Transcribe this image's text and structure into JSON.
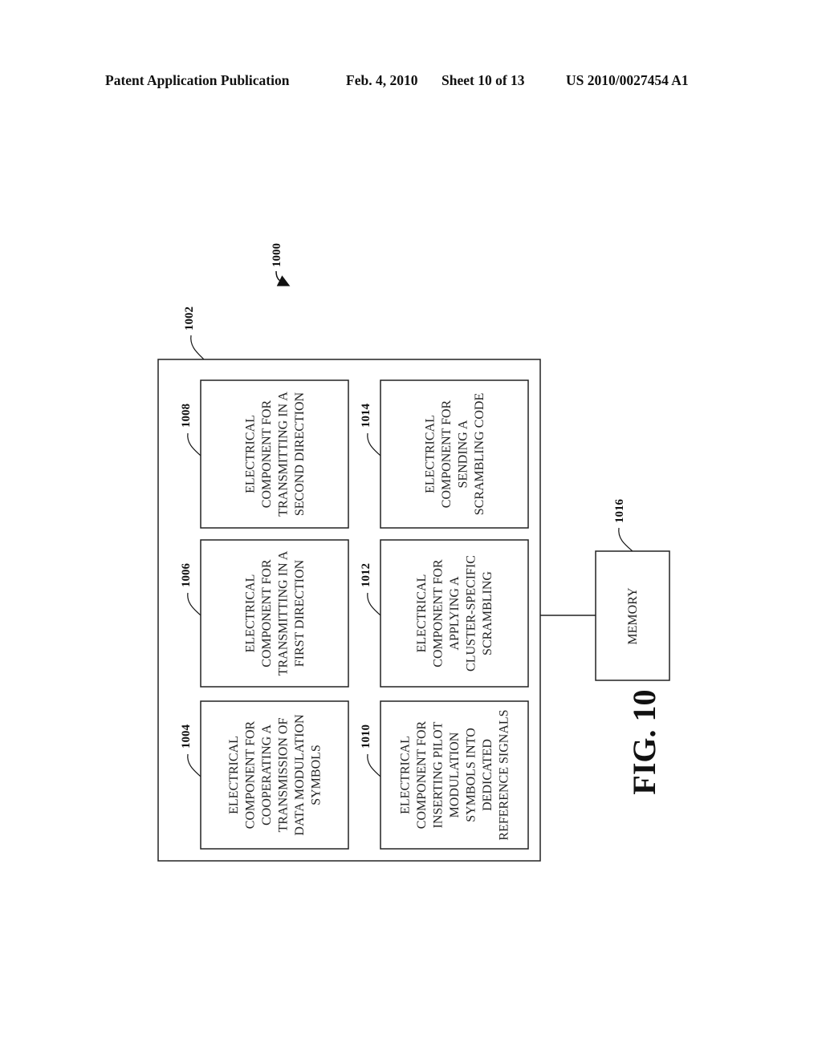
{
  "header": {
    "publication": "Patent Application Publication",
    "date": "Feb. 4, 2010",
    "sheet": "Sheet 10 of 13",
    "number": "US 2010/0027454 A1"
  },
  "diagram": {
    "system_ref": "1000",
    "container_ref": "1002",
    "components": [
      {
        "ref": "1004",
        "lines": [
          "ELECTRICAL",
          "COMPONENT FOR",
          "COOPERATING A",
          "TRANSMISSION OF",
          "DATA MODULATION",
          "SYMBOLS"
        ]
      },
      {
        "ref": "1006",
        "lines": [
          "ELECTRICAL",
          "COMPONENT FOR",
          "TRANSMITTING IN A",
          "FIRST DIRECTION"
        ]
      },
      {
        "ref": "1008",
        "lines": [
          "ELECTRICAL",
          "COMPONENT FOR",
          "TRANSMITTING IN A",
          "SECOND DIRECTION"
        ]
      },
      {
        "ref": "1010",
        "lines": [
          "ELECTRICAL",
          "COMPONENT FOR",
          "INSERTING PILOT",
          "MODULATION",
          "SYMBOLS INTO",
          "DEDICATED",
          "REFERENCE SIGNALS"
        ]
      },
      {
        "ref": "1012",
        "lines": [
          "ELECTRICAL",
          "COMPONENT FOR",
          "APPLYING A",
          "CLUSTER-SPECIFIC",
          "SCRAMBLING"
        ]
      },
      {
        "ref": "1014",
        "lines": [
          "ELECTRICAL",
          "COMPONENT FOR",
          "SENDING A",
          "SCRAMBLING CODE"
        ]
      }
    ],
    "memory": {
      "ref": "1016",
      "label": "MEMORY"
    },
    "figure_label": "FIG. 10"
  }
}
